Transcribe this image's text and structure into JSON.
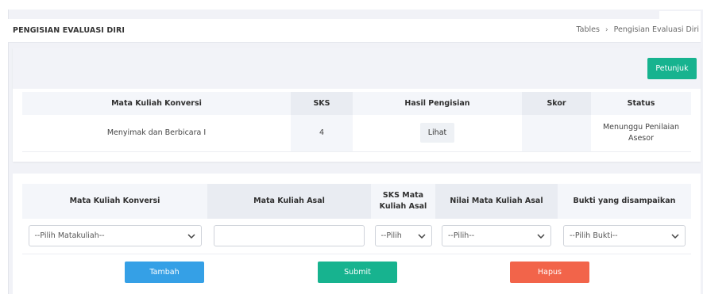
{
  "header": {
    "title": "PENGISIAN EVALUASI DIRI",
    "breadcrumb": [
      "Tables",
      "Pengisian Evaluasi Diri"
    ]
  },
  "actions": {
    "petunjuk_label": "Petunjuk"
  },
  "summary_table": {
    "headers": [
      "Mata Kuliah Konversi",
      "SKS",
      "Hasil Pengisian",
      "Skor",
      "Status"
    ],
    "rows": [
      {
        "mata_kuliah": "Menyimak dan Berbicara I",
        "sks": "4",
        "hasil_label": "Lihat",
        "skor": "",
        "status": "Menunggu Penilaian Asesor"
      }
    ]
  },
  "form_table": {
    "headers": [
      "Mata Kuliah Konversi",
      "Mata Kuliah Asal",
      "SKS Mata Kuliah Asal",
      "Nilai Mata Kuliah Asal",
      "Bukti yang disampaikan"
    ],
    "selects": {
      "matakuliah": "--Pilih Matakuliah--",
      "sks": "--Pilih",
      "nilai": "--Pilih--",
      "bukti": "--Pilih Bukti--"
    },
    "mata_kuliah_asal_value": ""
  },
  "buttons": {
    "tambah": "Tambah",
    "submit": "Submit",
    "hapus": "Hapus"
  },
  "colors": {
    "primary": "#35a0e6",
    "success": "#17b38f",
    "danger": "#f2644a"
  }
}
